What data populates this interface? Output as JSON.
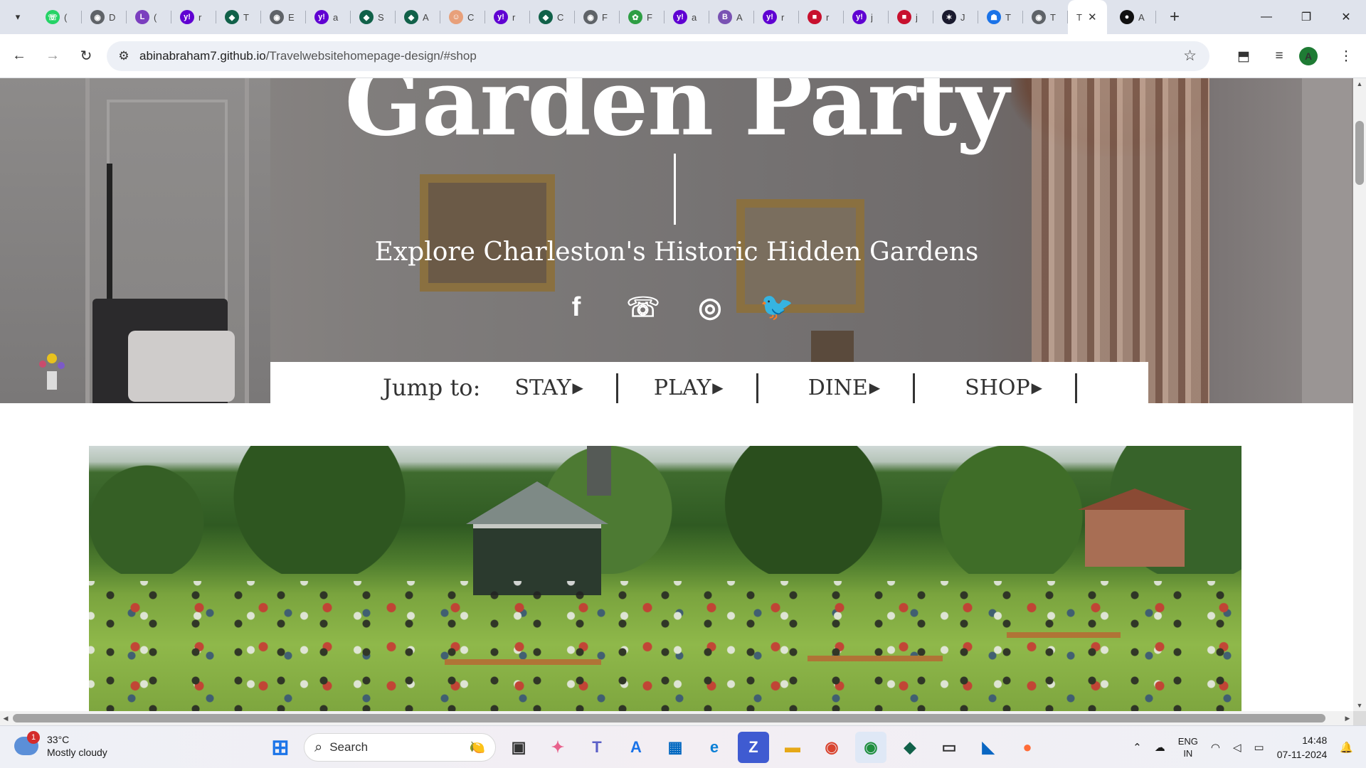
{
  "browser": {
    "tabs": [
      {
        "icon": "whatsapp-icon",
        "color": "#25d366",
        "glyph": "☏",
        "title": "("
      },
      {
        "icon": "globe-icon",
        "color": "#5f6368",
        "glyph": "◉",
        "title": "D"
      },
      {
        "icon": "l-icon",
        "color": "#7b3fbf",
        "glyph": "L",
        "title": "("
      },
      {
        "icon": "yahoo-icon",
        "color": "#6001d2",
        "glyph": "y!",
        "title": "r"
      },
      {
        "icon": "mongodb-icon",
        "color": "#116149",
        "glyph": "◆",
        "title": "T"
      },
      {
        "icon": "globe-icon",
        "color": "#5f6368",
        "glyph": "◉",
        "title": "E"
      },
      {
        "icon": "yahoo-icon",
        "color": "#6001d2",
        "glyph": "y!",
        "title": "a"
      },
      {
        "icon": "mongodb-icon",
        "color": "#116149",
        "glyph": "◆",
        "title": "S"
      },
      {
        "icon": "mongodb-icon",
        "color": "#116149",
        "glyph": "◆",
        "title": "A"
      },
      {
        "icon": "avatar-icon",
        "color": "#e8a07a",
        "glyph": "☺",
        "title": "C"
      },
      {
        "icon": "yahoo-icon",
        "color": "#6001d2",
        "glyph": "y!",
        "title": "r"
      },
      {
        "icon": "mongodb-icon",
        "color": "#116149",
        "glyph": "◆",
        "title": "C"
      },
      {
        "icon": "globe-icon",
        "color": "#5f6368",
        "glyph": "◉",
        "title": "F"
      },
      {
        "icon": "green-leaf-icon",
        "color": "#2e9e44",
        "glyph": "✿",
        "title": "F"
      },
      {
        "icon": "yahoo-icon",
        "color": "#6001d2",
        "glyph": "y!",
        "title": "a"
      },
      {
        "icon": "bootstrap-icon",
        "color": "#7952b3",
        "glyph": "B",
        "title": "A"
      },
      {
        "icon": "yahoo-icon",
        "color": "#6001d2",
        "glyph": "y!",
        "title": "r"
      },
      {
        "icon": "red-square-icon",
        "color": "#c8102e",
        "glyph": "■",
        "title": "r"
      },
      {
        "icon": "yahoo-icon",
        "color": "#6001d2",
        "glyph": "y!",
        "title": "j"
      },
      {
        "icon": "red-square-icon",
        "color": "#c8102e",
        "glyph": "■",
        "title": "j"
      },
      {
        "icon": "spark-icon",
        "color": "#1a1a2e",
        "glyph": "✶",
        "title": "J"
      },
      {
        "icon": "blue-user-icon",
        "color": "#1a73e8",
        "glyph": "☗",
        "title": "T"
      },
      {
        "icon": "globe-icon",
        "color": "#5f6368",
        "glyph": "◉",
        "title": "T"
      }
    ],
    "active_tab": {
      "title": "T",
      "close": "✕"
    },
    "github_tab": {
      "glyph": "●",
      "title": "A"
    },
    "new_tab": "+",
    "url_host": "abinabraham7.github.io",
    "url_path": "/Travelwebsitehomepage-design/#shop"
  },
  "page": {
    "hero_title": "Garden Party",
    "hero_subtitle": "Explore Charleston's Historic Hidden Gardens",
    "socials": [
      "facebook-icon",
      "whatsapp-icon",
      "instagram-icon",
      "twitter-icon"
    ],
    "social_glyphs": [
      "f",
      "☏",
      "◎",
      "🐦"
    ],
    "jump_label": "Jump to:",
    "jump_links": [
      {
        "label": "STAY"
      },
      {
        "label": "PLAY"
      },
      {
        "label": "DINE"
      },
      {
        "label": "SHOP"
      }
    ]
  },
  "taskbar": {
    "weather_temp": "33°C",
    "weather_desc": "Mostly cloudy",
    "weather_badge": "1",
    "search_label": "Search",
    "language": "ENG",
    "region": "IN",
    "time": "14:48",
    "date": "07-11-2024"
  }
}
